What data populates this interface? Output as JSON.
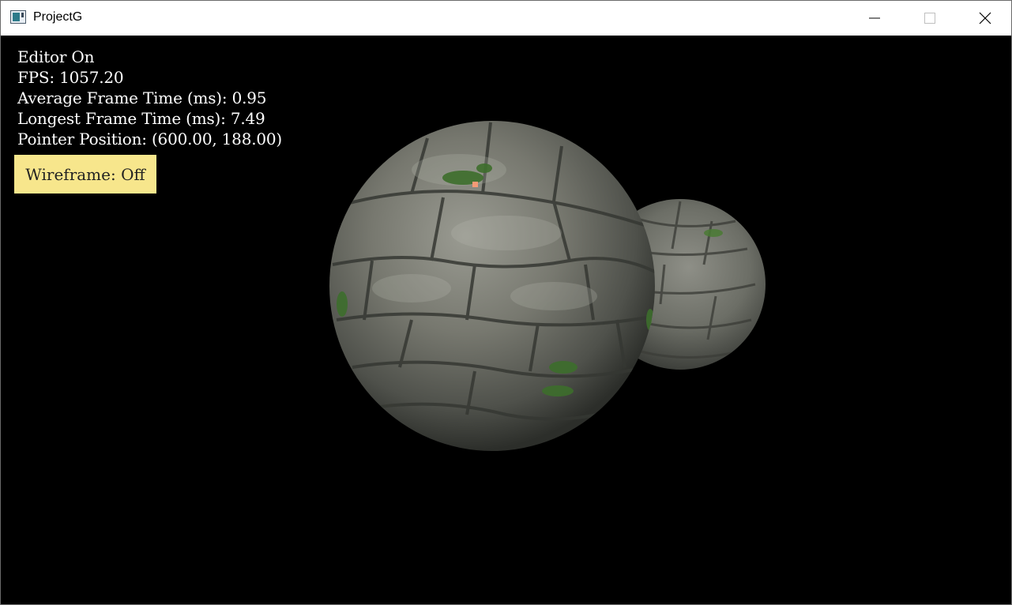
{
  "window": {
    "title": "ProjectG"
  },
  "hud": {
    "editor": "Editor On",
    "fps": "FPS: 1057.20",
    "avg_frame": "Average Frame Time (ms): 0.95",
    "longest_frame": "Longest Frame Time (ms): 7.49",
    "pointer": "Pointer Position: (600.00, 188.00)"
  },
  "wireframe_button": {
    "label": "Wireframe: Off",
    "color": "#f7e68c"
  },
  "colors": {
    "background": "#000000",
    "stone": "#6e706a",
    "moss": "#3f6a2e",
    "cursor_marker": "#f59a76"
  },
  "icons": {
    "app": "app-window-icon",
    "minimize": "minimize-icon",
    "maximize": "maximize-icon",
    "close": "close-icon"
  }
}
